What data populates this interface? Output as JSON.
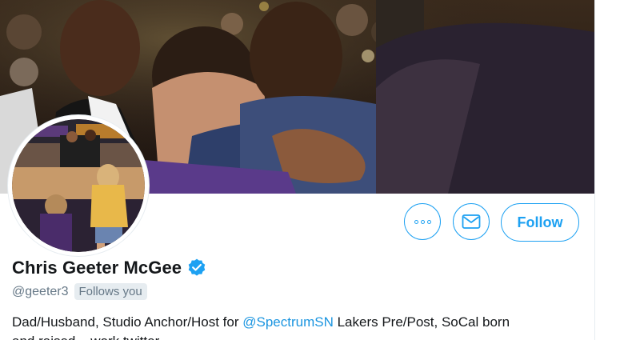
{
  "profile": {
    "display_name": "Chris Geeter McGee",
    "handle": "@geeter3",
    "follows_you_label": "Follows you",
    "bio_prefix": "Dad/Husband, Studio Anchor/Host for ",
    "bio_mention": "@SpectrumSN",
    "bio_suffix": " Lakers Pre/Post, SoCal born",
    "bio_line2": "and raised... work twitter"
  },
  "actions": {
    "more_icon": "more-horizontal-icon",
    "dm_icon": "envelope-icon",
    "follow_label": "Follow"
  },
  "colors": {
    "accent": "#1da1f2",
    "mention": "#1b95e0",
    "secondary_text": "#657786",
    "badge_bg": "#e6ecf0"
  },
  "images": {
    "header": "header-photo",
    "avatar": "profile-avatar"
  }
}
